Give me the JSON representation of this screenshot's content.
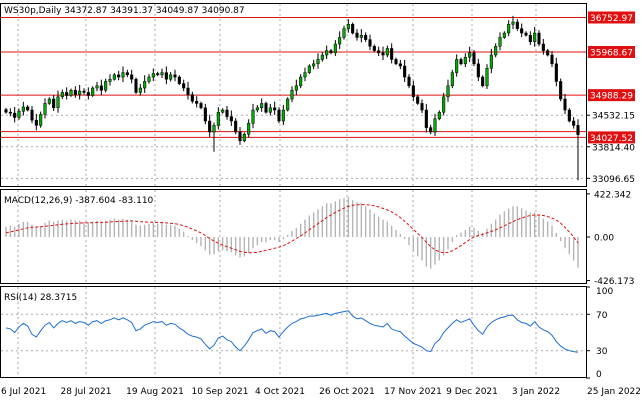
{
  "chart_data": [
    {
      "type": "candlestick",
      "panel": "price",
      "header": "WS30p,Daily  34372.87 34391.37 34049.87 34090.87",
      "symbol": "WS30p,Daily",
      "ohlc_readout": [
        "34372.87",
        "34391.37",
        "34049.87",
        "34090.87"
      ],
      "ylim": [
        32900,
        37060
      ],
      "y_tick_labels": [
        "36752.97",
        "35968.67",
        "34988.29",
        "34532.15",
        "34027.52",
        "33814.40",
        "33096.65"
      ],
      "y_tick_values": [
        36752.97,
        35968.67,
        34988.29,
        34532.15,
        34027.52,
        33814.4,
        33096.65
      ],
      "highlighted_levels": [
        36752.97,
        35968.67,
        34988.29,
        34027.52
      ],
      "plain_levels": [
        34532.15,
        33814.4,
        33096.65
      ],
      "horizontal_lines": [
        36752.97,
        35968.67,
        34988.29,
        34160,
        34027.52
      ],
      "x_tick_labels": [
        "6 Jul 2021",
        "28 Jul 2021",
        "19 Aug 2021",
        "10 Sep 2021",
        "4 Oct 2021",
        "26 Oct 2021",
        "17 Nov 2021",
        "9 Dec 2021",
        "3 Jan 2022",
        "25 Jan 2022"
      ],
      "close_path": [
        34600,
        34580,
        34480,
        34620,
        34720,
        34650,
        34420,
        34300,
        34550,
        34800,
        34900,
        34700,
        34950,
        35050,
        34980,
        35100,
        35000,
        35080,
        35050,
        34980,
        35150,
        35200,
        35100,
        35300,
        35350,
        35450,
        35400,
        35500,
        35450,
        35350,
        35050,
        35150,
        35300,
        35400,
        35480,
        35450,
        35500,
        35350,
        35450,
        35400,
        35250,
        35150,
        35000,
        34850,
        34800,
        34700,
        34400,
        34150,
        34300,
        34600,
        34650,
        34500,
        34400,
        34150,
        33950,
        34100,
        34350,
        34650,
        34700,
        34800,
        34600,
        34700,
        34650,
        34400,
        34650,
        34900,
        35100,
        35200,
        35400,
        35500,
        35650,
        35700,
        35800,
        35900,
        36000,
        35950,
        36150,
        36300,
        36500,
        36600,
        36400,
        36300,
        36350,
        36250,
        36100,
        36000,
        35950,
        35900,
        36050,
        35800,
        35700,
        35650,
        35400,
        35200,
        34950,
        34800,
        34650,
        34250,
        34150,
        34450,
        34600,
        34950,
        35200,
        35500,
        35800,
        35700,
        35850,
        35950,
        35700,
        35400,
        35200,
        35600,
        35900,
        36100,
        36300,
        36400,
        36600,
        36650,
        36500,
        36400,
        36350,
        36200,
        36400,
        36150,
        36000,
        35900,
        35700,
        35300,
        34900,
        34650,
        34400,
        34300,
        34090
      ]
    },
    {
      "type": "macd",
      "panel": "macd",
      "label": "MACD(12,26,9) -387.604 -83.110",
      "title": "MACD(12,26,9)",
      "readout_values": [
        "-387.604",
        "-83.110"
      ],
      "ylim": [
        -460,
        460
      ],
      "y_tick_labels": [
        "422.342",
        "0.00",
        "-426.173"
      ],
      "y_tick_values": [
        422.342,
        0,
        -426.173
      ],
      "series": [
        {
          "style": "histogram",
          "values": [
            100,
            110,
            100,
            130,
            150,
            150,
            120,
            100,
            110,
            140,
            160,
            150,
            160,
            170,
            160,
            170,
            160,
            160,
            150,
            140,
            150,
            160,
            150,
            160,
            170,
            180,
            170,
            180,
            170,
            160,
            120,
            110,
            120,
            130,
            140,
            130,
            140,
            120,
            120,
            110,
            80,
            50,
            10,
            -30,
            -60,
            -90,
            -130,
            -170,
            -170,
            -140,
            -130,
            -140,
            -150,
            -180,
            -200,
            -190,
            -160,
            -110,
            -80,
            -50,
            -50,
            -30,
            -30,
            -50,
            -20,
            20,
            60,
            90,
            130,
            170,
            210,
            240,
            270,
            300,
            330,
            330,
            350,
            370,
            380,
            390,
            360,
            340,
            330,
            300,
            270,
            230,
            200,
            170,
            150,
            110,
            70,
            30,
            -20,
            -80,
            -140,
            -190,
            -230,
            -290,
            -310,
            -270,
            -230,
            -180,
            -120,
            -50,
            20,
            40,
            70,
            100,
            90,
            60,
            40,
            80,
            130,
            170,
            220,
            250,
            280,
            300,
            300,
            280,
            260,
            240,
            240,
            210,
            180,
            150,
            110,
            40,
            -40,
            -110,
            -170,
            -230,
            -300
          ]
        },
        {
          "style": "dashed-signal",
          "values": [
            40,
            50,
            60,
            70,
            80,
            90,
            95,
            98,
            100,
            105,
            110,
            115,
            120,
            125,
            128,
            132,
            135,
            137,
            138,
            139,
            140,
            142,
            143,
            145,
            147,
            150,
            152,
            155,
            157,
            158,
            155,
            150,
            147,
            145,
            144,
            142,
            141,
            138,
            134,
            130,
            122,
            110,
            95,
            78,
            60,
            40,
            15,
            -15,
            -40,
            -60,
            -80,
            -95,
            -110,
            -125,
            -140,
            -150,
            -155,
            -155,
            -150,
            -140,
            -130,
            -120,
            -110,
            -100,
            -85,
            -65,
            -40,
            -15,
            10,
            40,
            70,
            100,
            130,
            160,
            190,
            215,
            240,
            262,
            282,
            300,
            310,
            315,
            318,
            316,
            312,
            305,
            295,
            280,
            265,
            245,
            220,
            190,
            155,
            115,
            75,
            35,
            -5,
            -50,
            -95,
            -125,
            -145,
            -155,
            -150,
            -135,
            -110,
            -85,
            -55,
            -25,
            0,
            15,
            25,
            40,
            55,
            70,
            90,
            110,
            130,
            150,
            170,
            185,
            200,
            210,
            215,
            215,
            210,
            200,
            185,
            165,
            135,
            95,
            50,
            0,
            -60
          ]
        }
      ]
    },
    {
      "type": "line",
      "panel": "rsi",
      "label": "RSI(14) 28.3715",
      "title": "RSI(14)",
      "readout_value": "28.3715",
      "ylim": [
        0,
        100
      ],
      "y_tick_labels": [
        "100",
        "70",
        "30",
        "0"
      ],
      "y_tick_values": [
        100,
        70,
        30,
        0
      ],
      "reference_lines": [
        70,
        30
      ],
      "series": [
        {
          "color": "#1e6fd0",
          "values": [
            55,
            54,
            50,
            56,
            60,
            57,
            48,
            45,
            52,
            58,
            61,
            55,
            60,
            63,
            61,
            63,
            60,
            62,
            61,
            58,
            62,
            63,
            60,
            63,
            64,
            66,
            64,
            66,
            64,
            61,
            52,
            54,
            58,
            60,
            62,
            61,
            62,
            58,
            60,
            59,
            55,
            52,
            48,
            46,
            45,
            43,
            37,
            32,
            36,
            44,
            46,
            42,
            40,
            34,
            30,
            35,
            42,
            50,
            52,
            54,
            49,
            52,
            51,
            45,
            51,
            56,
            60,
            62,
            65,
            66,
            68,
            68,
            69,
            70,
            71,
            69,
            71,
            72,
            73,
            74,
            68,
            65,
            66,
            63,
            60,
            58,
            57,
            56,
            60,
            54,
            52,
            51,
            46,
            42,
            38,
            36,
            34,
            30,
            29,
            38,
            42,
            50,
            55,
            60,
            64,
            61,
            63,
            65,
            58,
            52,
            48,
            56,
            61,
            64,
            66,
            67,
            69,
            69,
            64,
            61,
            60,
            57,
            62,
            56,
            53,
            51,
            47,
            40,
            35,
            32,
            30,
            29,
            28.37
          ]
        }
      ]
    }
  ]
}
